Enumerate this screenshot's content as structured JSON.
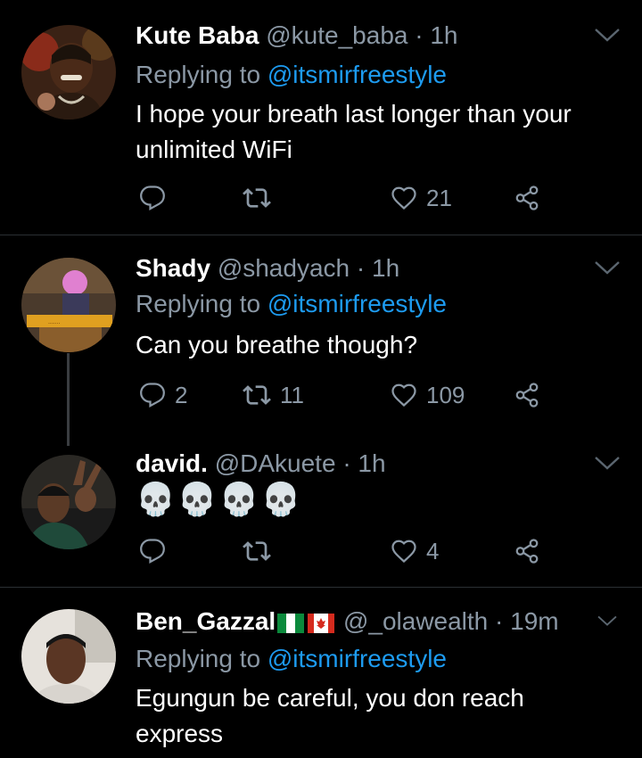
{
  "tweets": [
    {
      "name": "Kute Baba",
      "handle": "@kute_baba",
      "separator": "·",
      "time": "1h",
      "replying_prefix": "Replying to",
      "replying_to": "@itsmirfreestyle",
      "text": "I hope your breath last longer than your unlimited WiFi",
      "reply_count": "",
      "retweet_count": "",
      "like_count": "21"
    },
    {
      "name": "Shady",
      "handle": "@shadyach",
      "separator": "·",
      "time": "1h",
      "replying_prefix": "Replying to",
      "replying_to": "@itsmirfreestyle",
      "text": "Can you breathe though?",
      "reply_count": "2",
      "retweet_count": "11",
      "like_count": "109"
    },
    {
      "name": "david.",
      "handle": "@DAkuete",
      "separator": "·",
      "time": "1h",
      "text": "💀💀💀💀",
      "reply_count": "",
      "retweet_count": "",
      "like_count": "4"
    },
    {
      "name": "Ben_Gazzal",
      "handle": "@_olawealth",
      "separator": "·",
      "time": "19m",
      "replying_prefix": "Replying to",
      "replying_to": "@itsmirfreestyle",
      "text": "Egungun be careful, you don reach express",
      "flags": [
        "nigeria-flag",
        "canada-flag"
      ]
    }
  ],
  "colors": {
    "background": "#000000",
    "text": "#ffffff",
    "muted": "#8b98a5",
    "link": "#1d9bf0",
    "divider": "#2b2f33"
  },
  "icons": [
    "reply-icon",
    "retweet-icon",
    "heart-icon",
    "share-icon",
    "chevron-down-icon",
    "skull-emoji"
  ]
}
